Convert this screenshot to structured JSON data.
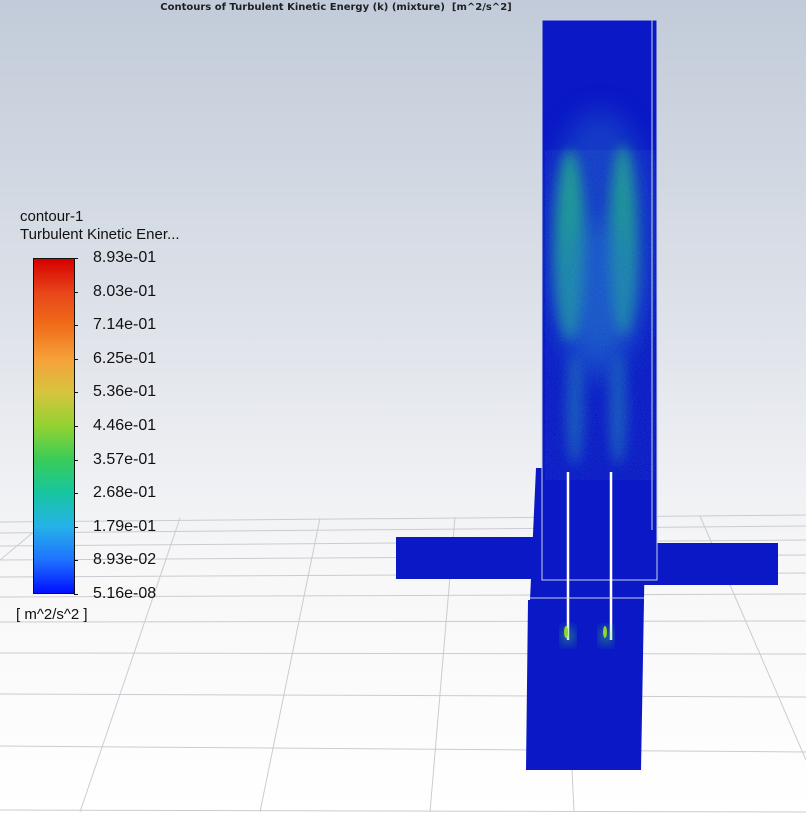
{
  "title": "Contours of Turbulent Kinetic Energy (k) (mixture)  [m^2/s^2]",
  "legend": {
    "name": "contour-1",
    "field": "Turbulent Kinetic Ener...",
    "units": "[ m^2/s^2 ]",
    "levels": [
      "8.93e-01",
      "8.03e-01",
      "7.14e-01",
      "6.25e-01",
      "5.36e-01",
      "4.46e-01",
      "3.57e-01",
      "2.68e-01",
      "1.79e-01",
      "8.93e-02",
      "5.16e-08"
    ],
    "colors": [
      "#d50000",
      "#e8451a",
      "#f06d19",
      "#f6a13a",
      "#d6c43e",
      "#93d232",
      "#39cc58",
      "#16c6a0",
      "#25b2e8",
      "#1f73ff",
      "#0010ff"
    ]
  },
  "colors": {
    "domain_fill": "#0a18c6",
    "wall": "#ffffff",
    "plume": "#1fa38e"
  }
}
